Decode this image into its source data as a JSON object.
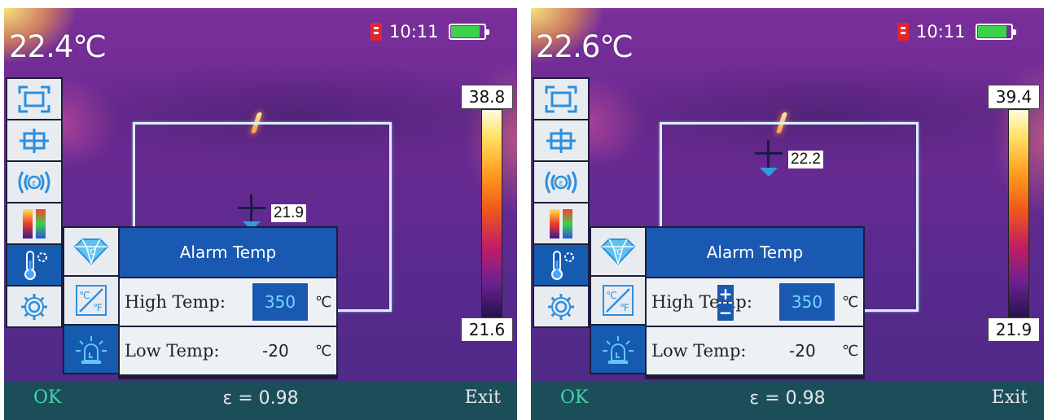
{
  "screens": [
    {
      "main_temp": "22.4℃",
      "time": "10:11",
      "scale_max": "38.8",
      "scale_min": "21.6",
      "crosshair_temp": "21.9",
      "panel_title": "Alarm Temp",
      "high_label": "High Temp:",
      "high_value": "350",
      "high_unit": "℃",
      "low_label": "Low Temp:",
      "low_value": "-20",
      "low_unit": "℃",
      "ok_label": "OK",
      "emissivity": "ε = 0.98",
      "exit_label": "Exit"
    },
    {
      "main_temp": "22.6℃",
      "time": "10:11",
      "scale_max": "39.4",
      "scale_min": "21.9",
      "crosshair_temp": "22.2",
      "panel_title": "Alarm Temp",
      "high_label": "High Temp:",
      "high_value": "350",
      "high_unit": "℃",
      "low_label": "Low Temp:",
      "low_value": "-20",
      "low_unit": "℃",
      "stepper_plus": "+",
      "stepper_minus": "−",
      "ok_label": "OK",
      "emissivity": "ε = 0.98",
      "exit_label": "Exit"
    }
  ],
  "battery_level": 0.85,
  "colors": {
    "accent_blue": "#1a59b2",
    "ok_green": "#43d6a7",
    "bottom_bar": "#1c4e5a",
    "battery_green": "#3ed14f",
    "sd_red": "#e3262c"
  },
  "icons": {
    "menu": [
      "area-measure-icon",
      "center-point-icon",
      "emissivity-icon",
      "palette-icon",
      "alarm-thermometer-icon",
      "settings-gear-icon"
    ],
    "submenu": [
      "diamond-temp-icon",
      "unit-switch-icon",
      "alarm-siren-icon"
    ]
  }
}
